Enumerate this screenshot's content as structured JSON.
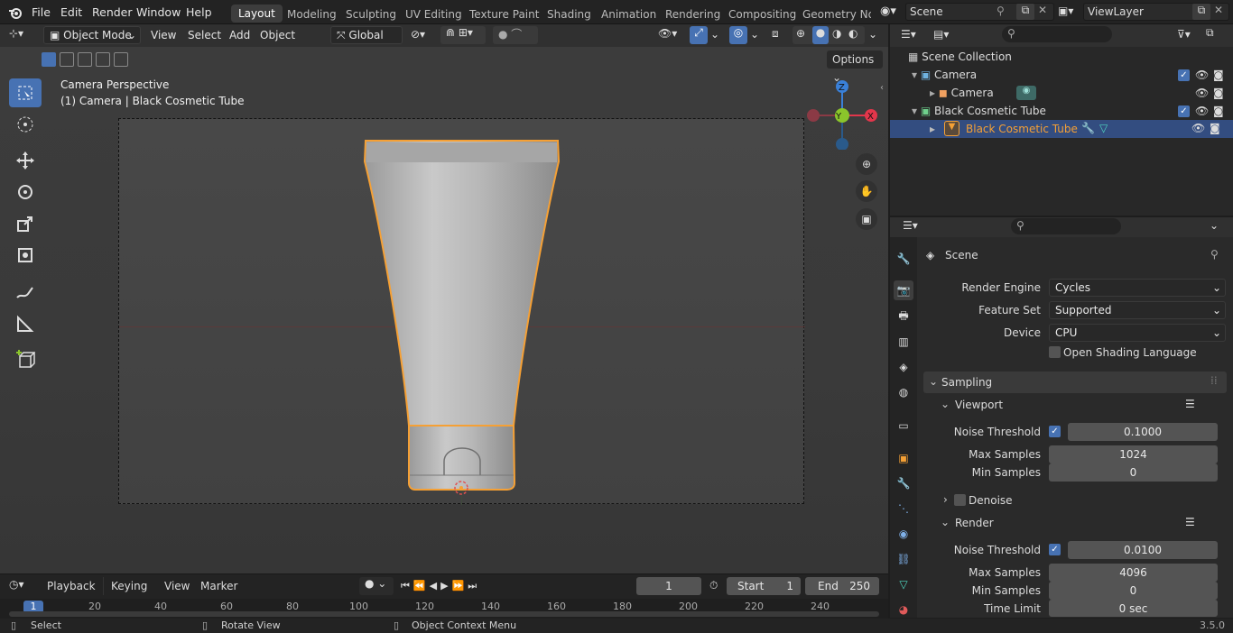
{
  "menu": [
    "File",
    "Edit",
    "Render",
    "Window",
    "Help"
  ],
  "workspaces": [
    "Layout",
    "Modeling",
    "Sculpting",
    "UV Editing",
    "Texture Paint",
    "Shading",
    "Animation",
    "Rendering",
    "Compositing",
    "Geometry Noc"
  ],
  "scene_name": "Scene",
  "view_layer": "ViewLayer",
  "header": {
    "mode": "Object Mode",
    "view": "View",
    "select": "Select",
    "add": "Add",
    "object": "Object",
    "orientation": "Global",
    "options": "Options"
  },
  "viewport": {
    "title": "Camera Perspective",
    "subtitle": "(1) Camera | Black Cosmetic Tube",
    "gizmo": {
      "z": "Z",
      "y": "Y",
      "x": "X"
    }
  },
  "outliner": {
    "root": "Scene Collection",
    "items": [
      {
        "label": "Camera",
        "type": "collection"
      },
      {
        "label": "Camera",
        "type": "object"
      },
      {
        "label": "Black Cosmetic Tube",
        "type": "collection"
      },
      {
        "label": "Black Cosmetic Tube",
        "type": "object",
        "selected": true
      }
    ]
  },
  "properties": {
    "context": "Scene",
    "render_engine_label": "Render Engine",
    "render_engine": "Cycles",
    "feature_set_label": "Feature Set",
    "feature_set": "Supported",
    "device_label": "Device",
    "device": "CPU",
    "osl_label": "Open Shading Language",
    "sampling": "Sampling",
    "viewport_panel": "Viewport",
    "noise_threshold_label": "Noise Threshold",
    "viewport_noise": "0.1000",
    "max_samples_label": "Max Samples",
    "viewport_max": "1024",
    "min_samples_label": "Min Samples",
    "viewport_min": "0",
    "denoise": "Denoise",
    "render_panel": "Render",
    "render_noise": "0.0100",
    "render_max": "4096",
    "render_min": "0",
    "time_limit_label": "Time Limit",
    "time_limit": "0 sec"
  },
  "timeline": {
    "playback": "Playback",
    "keying": "Keying",
    "view": "View",
    "marker": "Marker",
    "current_frame": "1",
    "start_label": "Start",
    "start": "1",
    "end_label": "End",
    "end": "250",
    "ruler": [
      "1",
      "20",
      "40",
      "60",
      "80",
      "100",
      "120",
      "140",
      "160",
      "180",
      "200",
      "220",
      "240"
    ]
  },
  "status": {
    "select": "Select",
    "rotate": "Rotate View",
    "context_menu": "Object Context Menu",
    "version": "3.5.0"
  },
  "colors": {
    "accent": "#4772b3",
    "selection": "#f5a035",
    "x_axis": "#e2364b",
    "y_axis": "#8bc52b",
    "z_axis": "#3a80d8"
  }
}
